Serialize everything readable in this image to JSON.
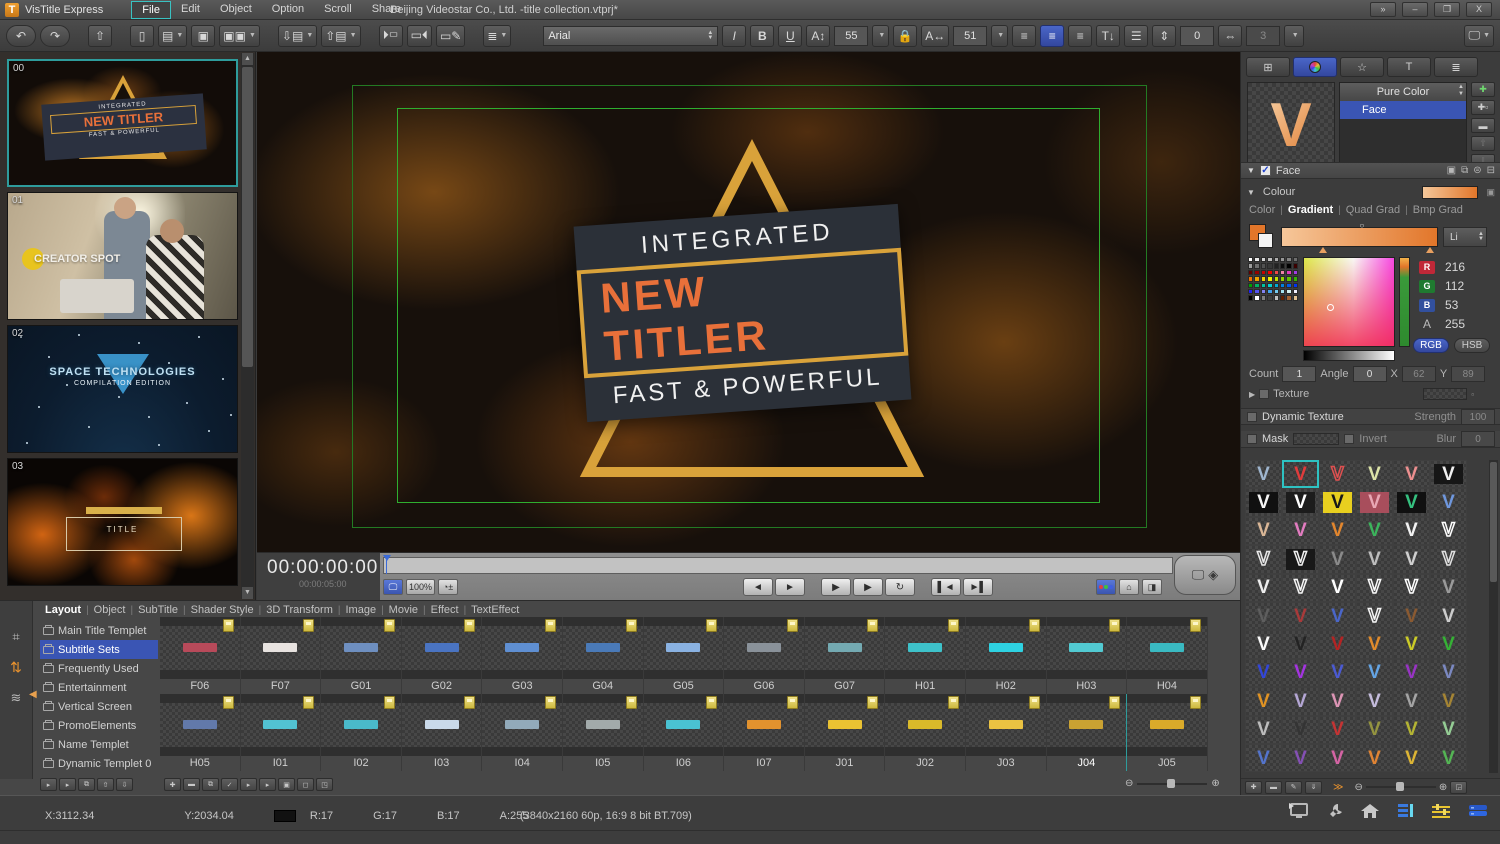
{
  "window": {
    "app_title": "VisTitle Express",
    "menu_items": [
      "File",
      "Edit",
      "Object",
      "Option",
      "Scroll",
      "Share"
    ],
    "active_menu": "File",
    "document_title": "Beijing Videostar Co., Ltd. -title collection.vtprj*"
  },
  "toolbar": {
    "font_family": "Arial",
    "italic": "I",
    "bold": "B",
    "underline": "U",
    "font_size": "55",
    "char_scale": "51",
    "line_value": "0",
    "kern_value": "3"
  },
  "thumbnail_panel": {
    "items": [
      {
        "index": "00",
        "type": "new-titler",
        "line1": "INTEGRATED",
        "line2": "NEW TITLER",
        "line3": "FAST & POWERFUL"
      },
      {
        "index": "01",
        "type": "creator-spot",
        "logo": "CREATOR SPOT"
      },
      {
        "index": "02",
        "type": "space",
        "title": "SPACE TECHNOLOGIES",
        "subtitle": "COMPILATION EDITION"
      },
      {
        "index": "03",
        "type": "fire",
        "caption": "TITLE"
      }
    ]
  },
  "preview": {
    "banner": {
      "top": "INTEGRATED",
      "title": "NEW TITLER",
      "bottom": "FAST & POWERFUL"
    }
  },
  "transport": {
    "timecode": "00:00:00:00",
    "duration": "00:00:05:00",
    "zoom_label": "100%"
  },
  "library": {
    "tabs": [
      "Layout",
      "Object",
      "SubTitle",
      "Shader Style",
      "3D Transform",
      "Image",
      "Movie",
      "Effect",
      "TextEffect"
    ],
    "active_tab": "Layout",
    "categories": [
      "Main Title Templet",
      "Subtitle Sets",
      "Frequently Used",
      "Entertainment",
      "Vertical Screen",
      "PromoElements",
      "Name Templet",
      "Dynamic Templet 0"
    ],
    "active_category": "Subtitle Sets",
    "selected_template": "J04",
    "row1": [
      {
        "label": "F06",
        "color": "#b84a5a"
      },
      {
        "label": "F07",
        "color": "#e8e3e0"
      },
      {
        "label": "G01",
        "color": "#6e8fc0"
      },
      {
        "label": "G02",
        "color": "#4a74c2"
      },
      {
        "label": "G03",
        "color": "#5f8fd2"
      },
      {
        "label": "G04",
        "color": "#4a7ab8"
      },
      {
        "label": "G05",
        "color": "#8ab2e2"
      },
      {
        "label": "G06",
        "color": "#8a929a"
      },
      {
        "label": "G07",
        "color": "#74aab2"
      },
      {
        "label": "H01",
        "color": "#3ec2ca"
      },
      {
        "label": "H02",
        "color": "#2ed2e2"
      },
      {
        "label": "H03",
        "color": "#52cad2"
      },
      {
        "label": "H04",
        "color": "#3abac2"
      }
    ],
    "row2": [
      {
        "label": "H05",
        "color": "#6279aa"
      },
      {
        "label": "I01",
        "color": "#52c2d2"
      },
      {
        "label": "I02",
        "color": "#4abaca"
      },
      {
        "label": "I03",
        "color": "#cadaea"
      },
      {
        "label": "I04",
        "color": "#92aaba"
      },
      {
        "label": "I05",
        "color": "#a2aaaa"
      },
      {
        "label": "I06",
        "color": "#4ac2d2"
      },
      {
        "label": "I07",
        "color": "#e2922e"
      },
      {
        "label": "J01",
        "color": "#eac232"
      },
      {
        "label": "J02",
        "color": "#daba2a"
      },
      {
        "label": "J03",
        "color": "#eac242"
      },
      {
        "label": "J04",
        "color": "#caa232"
      },
      {
        "label": "J05",
        "color": "#daaa2a"
      }
    ]
  },
  "right_panel": {
    "tabs": [
      "transform",
      "colour",
      "effects",
      "text-style",
      "layer-style"
    ],
    "active_tab_index": 1,
    "layer_type": "Pure Color",
    "layers": [
      "Face"
    ],
    "selected_layer": "Face",
    "face_section_label": "Face",
    "colour_section_label": "Colour",
    "colour_modes": [
      "Color",
      "Gradient",
      "Quad Grad",
      "Bmp Grad"
    ],
    "active_mode": "Gradient",
    "gradient_interp": "Li",
    "channels": {
      "r_label": "R",
      "r": "216",
      "g_label": "G",
      "g": "112",
      "b_label": "B",
      "b": "53",
      "a_label": "A",
      "a": "255"
    },
    "color_space": {
      "rgb": "RGB",
      "hsb": "HSB",
      "active": "RGB"
    },
    "fields": {
      "count_label": "Count",
      "count": "1",
      "angle_label": "Angle",
      "angle": "0",
      "x_label": "X",
      "x": "62",
      "y_label": "Y",
      "y": "89"
    },
    "texture_label": "Texture",
    "dynamic_texture": {
      "label": "Dynamic Texture",
      "strength_label": "Strength",
      "strength": "100"
    },
    "mask": {
      "label": "Mask",
      "invert_label": "Invert",
      "blur_label": "Blur",
      "blur": "0"
    },
    "accent_selected": "#2ec2c2",
    "palette_colors": [
      "#ffffff",
      "#e9e9e9",
      "#d4d4d4",
      "#bfbfbf",
      "#ababab",
      "#969696",
      "#828282",
      "#6d6d6d",
      "#9c9c9c",
      "#6f6f6f",
      "#515151",
      "#383838",
      "#222222",
      "#0d0d0d",
      "#000000",
      "#3a0000",
      "#600000",
      "#930000",
      "#c60000",
      "#f00000",
      "#f04848",
      "#ef83a5",
      "#e23cbe",
      "#a23ce2",
      "#ef7100",
      "#efa100",
      "#efd100",
      "#eff000",
      "#c2e200",
      "#92d200",
      "#62c200",
      "#32b200",
      "#00a100",
      "#00b262",
      "#00c2a2",
      "#00d2d2",
      "#00aad8",
      "#0082e2",
      "#005ae8",
      "#0032f0",
      "#2222f0",
      "#5252f0",
      "#8282f0",
      "#42a2f0",
      "#72caf0",
      "#a2e2f0",
      "#d2f0f0",
      "#f0f0ff",
      "#000000",
      "#ffffff",
      "#7f7f7f",
      "#404040",
      "#bfbfbf",
      "#612000",
      "#a26232",
      "#e2c292"
    ],
    "style_grid": {
      "glyph": "V",
      "selected_row": 0,
      "selected_col": 1,
      "rows": [
        [
          {
            "c": "#9fb6cf"
          },
          {
            "c": "#e03c3c"
          },
          {
            "c": "#e05050",
            "ol": 1
          },
          {
            "c": "#dde4a8"
          },
          {
            "c": "#ec8f8f"
          },
          {
            "c": "#f0f0f0",
            "bg": "#161616"
          }
        ],
        [
          {
            "c": "#f5f5f5",
            "bg": "#101010"
          },
          {
            "c": "#ffffff",
            "bg": "#1c1c1c"
          },
          {
            "c": "#181818",
            "bg": "#e8cf1f"
          },
          {
            "c": "#e8a7b4",
            "bg": "#a84e5c"
          },
          {
            "c": "#35c07f",
            "bg": "#101010"
          },
          {
            "c": "#6f97dd"
          }
        ],
        [
          {
            "c": "#d9b696"
          },
          {
            "c": "#e27cc0"
          },
          {
            "c": "#e2862e"
          },
          {
            "c": "#3cb45c"
          },
          {
            "c": "#f2f2f2"
          },
          {
            "c": "#ffffff",
            "ol": 1
          }
        ],
        [
          {
            "c": "#e8e8e8",
            "ol": 1
          },
          {
            "c": "#f0f0f0",
            "ol": 1,
            "bg": "#181818"
          },
          {
            "c": "#8a8a8a"
          },
          {
            "c": "#bdbdbd"
          },
          {
            "c": "#cfcfcf"
          },
          {
            "c": "#e0e0e0",
            "ol": 1
          }
        ],
        [
          {
            "c": "#ededed"
          },
          {
            "c": "#f5f5f5",
            "ol": 1
          },
          {
            "c": "#ffffff"
          },
          {
            "c": "#fafafa",
            "ol": 1
          },
          {
            "c": "#ffffff",
            "ol": 1
          },
          {
            "c": "#9a9a9a"
          }
        ],
        [
          {
            "c": "#5e5e5e"
          },
          {
            "c": "#a83a3a"
          },
          {
            "c": "#4a66c8"
          },
          {
            "c": "#f5f5f5",
            "ol": 1
          },
          {
            "c": "#8a5a32"
          },
          {
            "c": "#cccccc"
          }
        ],
        [
          {
            "c": "#fafafa"
          },
          {
            "c": "#232323"
          },
          {
            "c": "#b42424"
          },
          {
            "c": "#df8b2c"
          },
          {
            "c": "#cbcb28"
          },
          {
            "c": "#35b135"
          }
        ],
        [
          {
            "c": "#3346d8"
          },
          {
            "c": "#a434e0"
          },
          {
            "c": "#4b5ad2"
          },
          {
            "c": "#64a4e4"
          },
          {
            "c": "#9834c4"
          },
          {
            "c": "#7b88c0"
          }
        ],
        [
          {
            "c": "#e09324"
          },
          {
            "c": "#b4a6d4"
          },
          {
            "c": "#dc94b4"
          },
          {
            "c": "#c4bcdc"
          },
          {
            "c": "#a4a4a4"
          },
          {
            "c": "#a48434"
          }
        ],
        [
          {
            "c": "#bcbcbc"
          },
          {
            "c": "#343434"
          },
          {
            "c": "#c43434"
          },
          {
            "c": "#949440"
          },
          {
            "c": "#b4b434"
          },
          {
            "c": "#94cc94"
          }
        ],
        [
          {
            "c": "#5474cc"
          },
          {
            "c": "#8450b4"
          },
          {
            "c": "#d464a4"
          },
          {
            "c": "#e08434"
          },
          {
            "c": "#dcb434"
          },
          {
            "c": "#54b454"
          }
        ]
      ]
    }
  },
  "status_bar": {
    "x": "X:3112.34",
    "y": "Y:2034.04",
    "r": "R:17",
    "g": "G:17",
    "b": "B:17",
    "a": "A:255",
    "format": "(3840x2160 60p, 16:9 8 bit BT.709)"
  }
}
